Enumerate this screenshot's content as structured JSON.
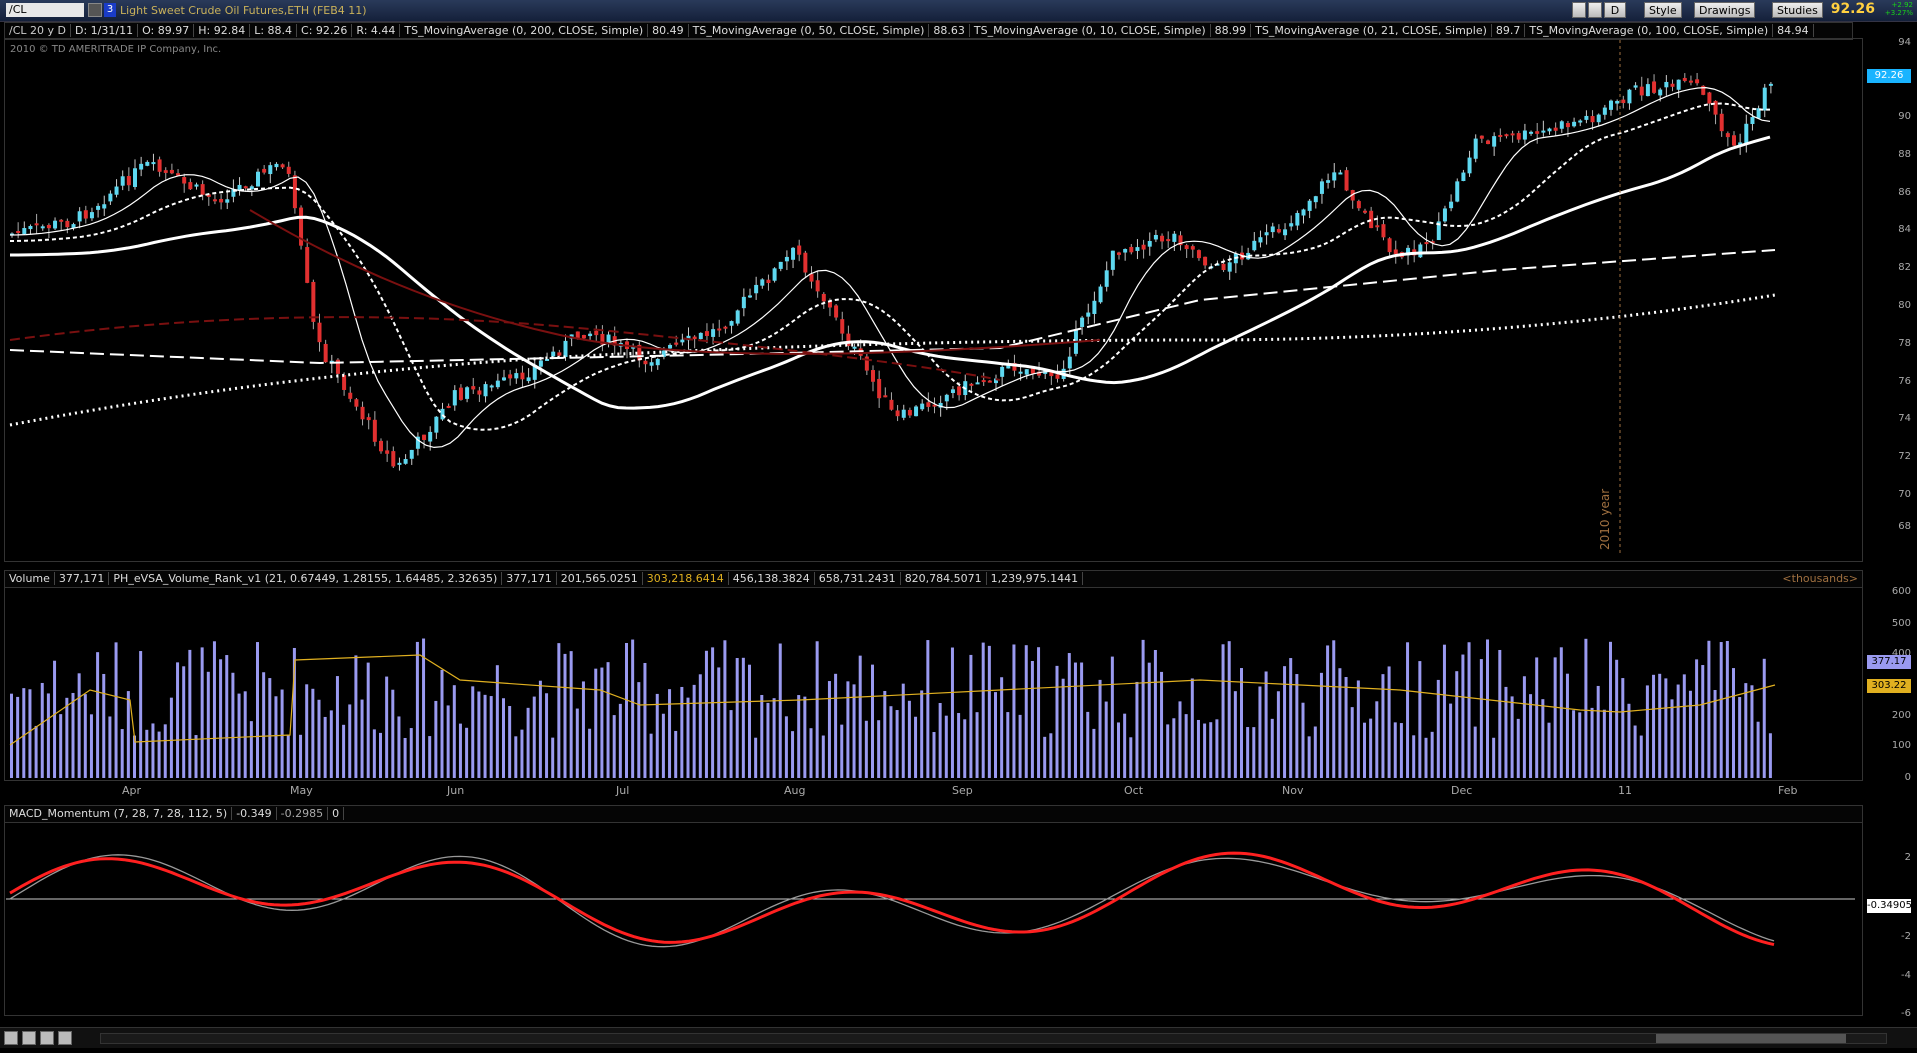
{
  "title_bar": {
    "symbol": "/CL",
    "link_number": "3",
    "description": "Light Sweet Crude Oil Futures,ETH (FEB4 11)",
    "buttons": {
      "interval": "D",
      "style": "Style",
      "drawings": "Drawings",
      "studies": "Studies"
    },
    "last_price": "92.26",
    "change": "+2.92",
    "change_pct": "+3.27%"
  },
  "info_bar": {
    "items": [
      "/CL 20 y D",
      "D: 1/31/11",
      "O: 89.97",
      "H: 92.84",
      "L: 88.4",
      "C: 92.26",
      "R: 4.44",
      "TS_MovingAverage (0, 200, CLOSE, Simple)",
      "80.49",
      "TS_MovingAverage (0, 50, CLOSE, Simple)",
      "88.63",
      "TS_MovingAverage (0, 10, CLOSE, Simple)",
      "88.99",
      "TS_MovingAverage (0, 21, CLOSE, Simple)",
      "89.7",
      "TS_MovingAverage (0, 100, CLOSE, Simple)",
      "84.94"
    ]
  },
  "copyright": "2010 © TD AMERITRADE IP Company, Inc.",
  "price_panel": {
    "y_ticks": [
      "94",
      "92",
      "90",
      "88",
      "86",
      "84",
      "82",
      "80",
      "78",
      "76",
      "74",
      "72",
      "70",
      "68"
    ],
    "last_badge": "92.26",
    "year_marker": "2010 year"
  },
  "volume_header": {
    "items": [
      "Volume",
      "377,171",
      "PH_eVSA_Volume_Rank_v1 (21, 0.67449, 1.28155, 1.64485, 2.32635)",
      "377,171",
      "201,565.0251",
      "303,218.6414",
      "456,138.3824",
      "658,731.2431",
      "820,784.5071",
      "1,239,975.1441"
    ],
    "units": "<thousands>"
  },
  "volume_panel": {
    "y_ticks": [
      "600",
      "500",
      "400",
      "300",
      "200",
      "100",
      "0"
    ],
    "badge_volume": "377.17",
    "badge_avg": "303.22"
  },
  "month_labels": [
    "Apr",
    "May",
    "Jun",
    "Jul",
    "Aug",
    "Sep",
    "Oct",
    "Nov",
    "Dec",
    "11",
    "Feb"
  ],
  "macd_header": {
    "items": [
      "MACD_Momentum (7, 28, 7, 28, 112, 5)",
      "-0.349",
      "-0.2985",
      "0"
    ]
  },
  "macd_panel": {
    "y_ticks": [
      "2",
      "0",
      "-2",
      "-4",
      "-6"
    ],
    "badge": "-0.34905"
  },
  "colors": {
    "up": "#5ed8f0",
    "down": "#e23030",
    "volume": "#9a9af0",
    "avg_line": "#e0b020",
    "macd_red": "#ff2020"
  }
}
